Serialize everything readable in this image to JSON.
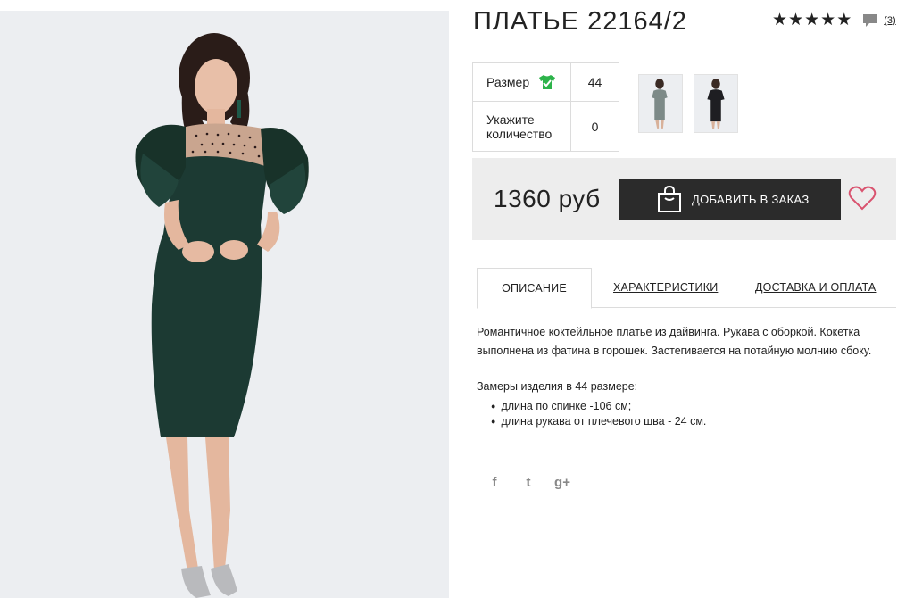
{
  "product": {
    "title": "ПЛАТЬЕ 22164/2",
    "rating_stars": 5,
    "review_count": "(3)"
  },
  "options": {
    "size_label": "Размер",
    "size_value": "44",
    "quantity_label": "Укажите количество",
    "quantity_value": "0"
  },
  "price": {
    "amount": "1360 руб",
    "order_button": "ДОБАВИТЬ В ЗАКАЗ"
  },
  "tabs": [
    {
      "label": "ОПИСАНИЕ",
      "active": true
    },
    {
      "label": "ХАРАКТЕРИСТИКИ",
      "active": false
    },
    {
      "label": "ДОСТАВКА И ОПЛАТА",
      "active": false
    }
  ],
  "description": {
    "text": "Романтичное коктейльное платье из дайвинга. Рукава с оборкой. Кокетка выполнена из фатина в горошек. Застегивается на потайную молнию сбоку.",
    "measurements_title": "Замеры изделия в 44 размере:",
    "measurements": [
      "длина по спинке -106 см;",
      "длина рукава от плечевого шва - 24 см."
    ]
  },
  "social": {
    "facebook": "f",
    "twitter": "t",
    "google": "g+"
  },
  "colors": {
    "dress": "#1c3a33",
    "button": "#2b2b2b",
    "size_icon": "#2db34a",
    "heart": "#d9536f"
  }
}
